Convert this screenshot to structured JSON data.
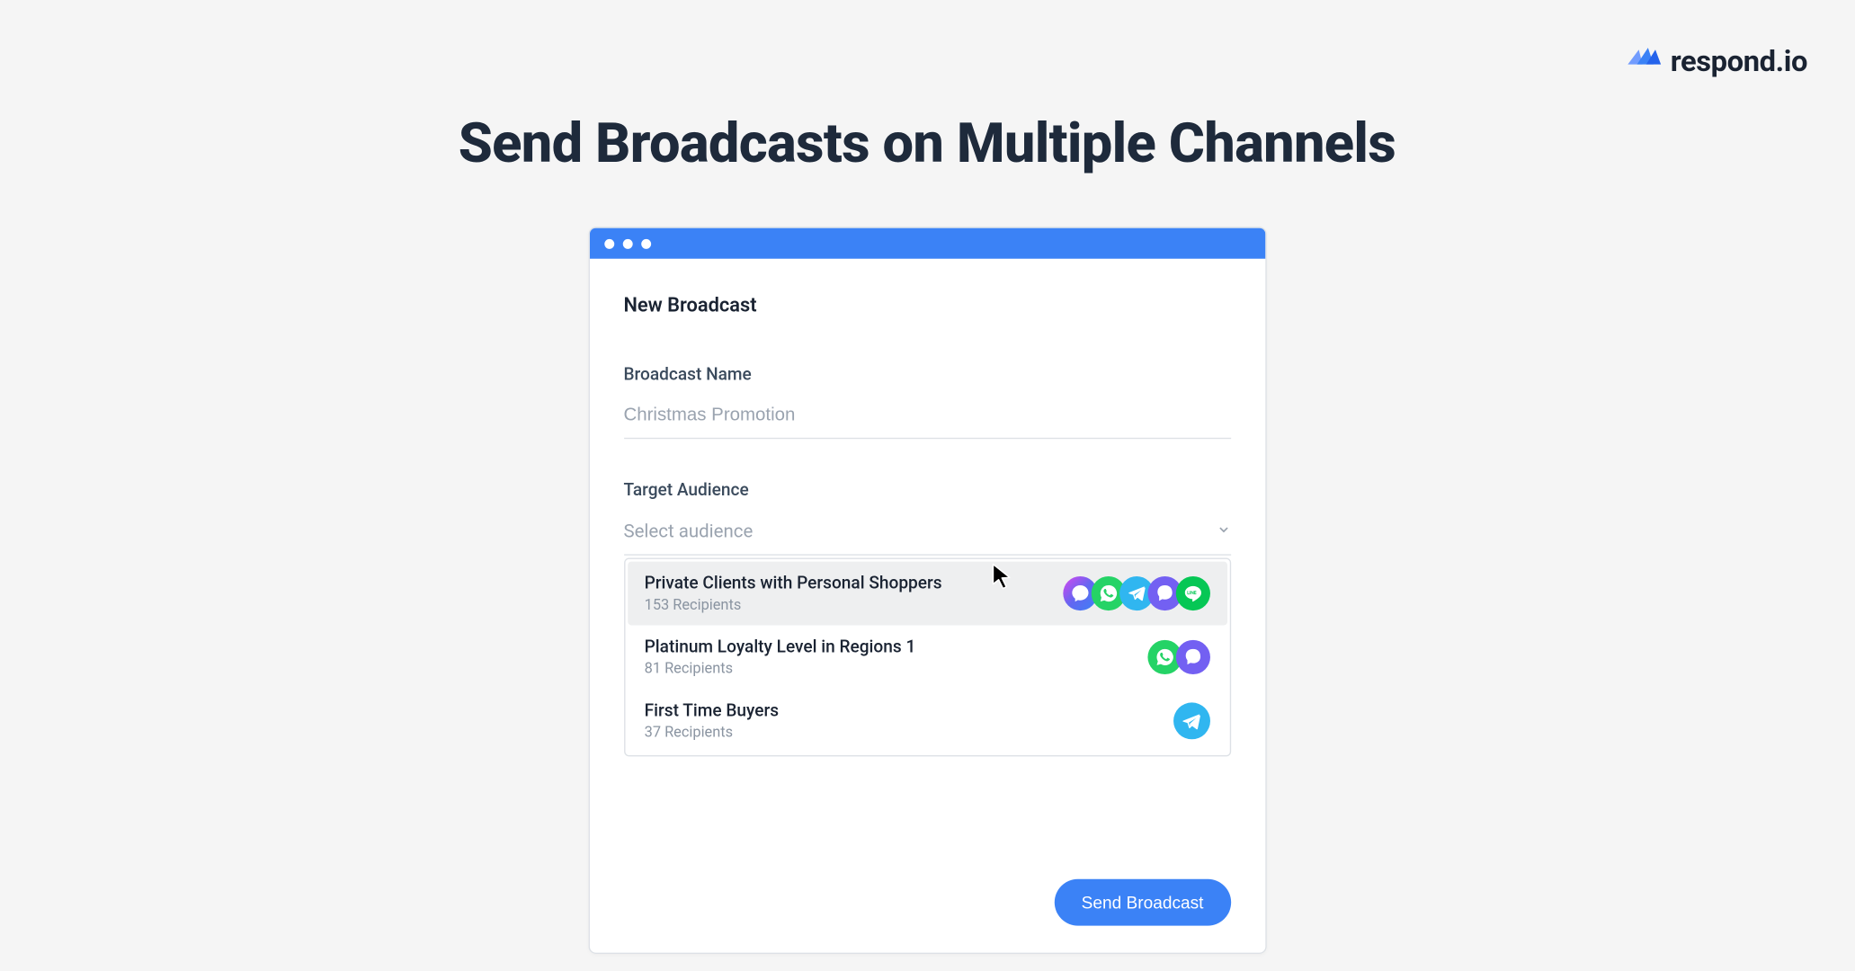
{
  "brand": {
    "name": "respond.io"
  },
  "page": {
    "title": "Send Broadcasts on Multiple Channels"
  },
  "modal": {
    "title": "New Broadcast",
    "broadcast_name_label": "Broadcast Name",
    "broadcast_name_value": "Christmas Promotion",
    "target_audience_label": "Target Audience",
    "target_audience_placeholder": "Select audience",
    "submit_label": "Send Broadcast"
  },
  "audiences": [
    {
      "name": "Private Clients with Personal Shoppers",
      "recipients": "153 Recipients",
      "channels": [
        "messenger",
        "whatsapp",
        "telegram",
        "viber",
        "line"
      ],
      "hovered": true
    },
    {
      "name": "Platinum Loyalty Level in Regions 1",
      "recipients": "81 Recipients",
      "channels": [
        "whatsapp",
        "viber"
      ],
      "hovered": false
    },
    {
      "name": "First Time Buyers",
      "recipients": "37 Recipients",
      "channels": [
        "telegram"
      ],
      "hovered": false
    }
  ]
}
